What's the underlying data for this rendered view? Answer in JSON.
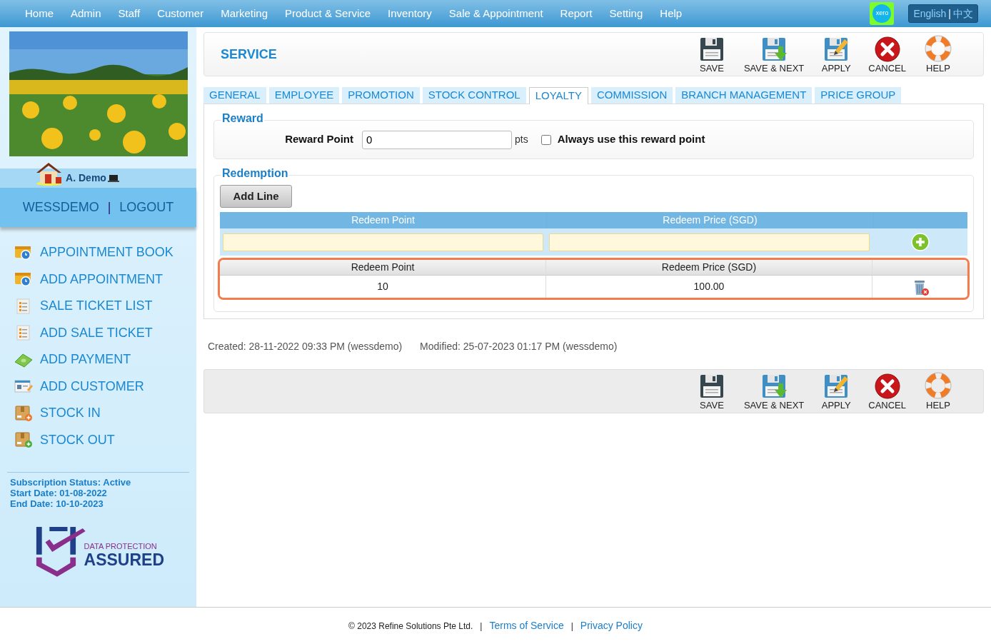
{
  "nav": {
    "items": [
      "Home",
      "Admin",
      "Staff",
      "Customer",
      "Marketing",
      "Product & Service",
      "Inventory",
      "Sale & Appointment",
      "Report",
      "Setting",
      "Help"
    ],
    "xero_logo": "xero",
    "language": {
      "english": "English",
      "separator": "|",
      "chinese": "中文"
    }
  },
  "sidebar": {
    "user": "A. Demo",
    "account": "WESSDEMO",
    "separator": "|",
    "logout": "LOGOUT",
    "menu": [
      {
        "label": "APPOINTMENT BOOK",
        "kind": "calendar"
      },
      {
        "label": "ADD APPOINTMENT",
        "kind": "calendar"
      },
      {
        "label": "SALE TICKET LIST",
        "kind": "ticket"
      },
      {
        "label": "ADD SALE TICKET",
        "kind": "ticket"
      },
      {
        "label": "ADD PAYMENT",
        "kind": "payment"
      },
      {
        "label": "ADD CUSTOMER",
        "kind": "customer"
      },
      {
        "label": "STOCK IN",
        "kind": "stock_in"
      },
      {
        "label": "STOCK OUT",
        "kind": "stock_out"
      }
    ],
    "subscription": [
      "Subscription Status: Active",
      "Start Date: 01-08-2022",
      "End Date: 10-10-2023"
    ],
    "badge": {
      "line1": "DATA PROTECTION",
      "line2": "ASSURED"
    }
  },
  "page": {
    "title": "SERVICE",
    "toolbar": [
      {
        "kind": "save",
        "label": "SAVE"
      },
      {
        "kind": "save_next",
        "label": "SAVE & NEXT"
      },
      {
        "kind": "apply",
        "label": "APPLY"
      },
      {
        "kind": "cancel",
        "label": "CANCEL"
      },
      {
        "kind": "help",
        "label": "HELP"
      }
    ],
    "tabs": [
      {
        "label": "GENERAL",
        "selected": false
      },
      {
        "label": "EMPLOYEE",
        "selected": false
      },
      {
        "label": "PROMOTION",
        "selected": false
      },
      {
        "label": "STOCK CONTROL",
        "selected": false
      },
      {
        "label": "LOYALTY",
        "selected": true
      },
      {
        "label": "COMMISSION",
        "selected": false
      },
      {
        "label": "BRANCH MANAGEMENT",
        "selected": false
      },
      {
        "label": "PRICE GROUP",
        "selected": false
      }
    ],
    "reward": {
      "legend": "Reward",
      "label": "Reward Point",
      "value": "0",
      "unit": "pts",
      "always_use": {
        "label": "Always use this reward point",
        "checked": false
      }
    },
    "redemption": {
      "legend": "Redemption",
      "add_button": "Add Line",
      "columns": [
        "Redeem Point",
        "Redeem Price (SGD)"
      ],
      "saved_columns": [
        "Redeem Point",
        "Redeem Price (SGD)"
      ],
      "rows": [
        {
          "point": "10",
          "price": "100.00"
        }
      ]
    },
    "created": "Created: 28-11-2022 09:33 PM (wessdemo)",
    "modified": "Modified: 25-07-2023 01:17 PM (wessdemo)",
    "bottom_toolbar": [
      {
        "kind": "save",
        "label": "SAVE"
      },
      {
        "kind": "save_next",
        "label": "SAVE & NEXT"
      },
      {
        "kind": "apply",
        "label": "APPLY"
      },
      {
        "kind": "cancel",
        "label": "CANCEL"
      },
      {
        "kind": "help",
        "label": "HELP"
      }
    ]
  },
  "footer": {
    "copyright": "© 2023 Refine Solutions Pte Ltd.",
    "links": [
      "Terms of Service",
      "Privacy Policy"
    ],
    "separator": "|"
  }
}
